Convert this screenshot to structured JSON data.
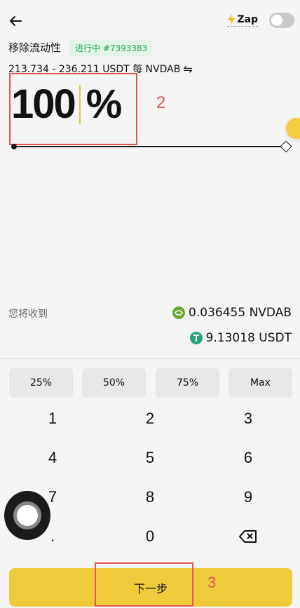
{
  "header": {
    "zap_label": "Zap"
  },
  "page": {
    "title": "移除流动性",
    "status_badge": "进行中 #7393383",
    "range_text": "213.734 - 236.211 USDT 每 NVDAB"
  },
  "amount": {
    "value": "100",
    "unit": "%",
    "percent_level": 1.0
  },
  "annotations": {
    "box_label_2": "2",
    "box_label_3": "3",
    "color": "#e05555"
  },
  "receive": {
    "label": "您将收到",
    "items": [
      {
        "amount": "0.036455 NVDAB",
        "icon": "nvidia-coin-icon",
        "color": "#6aa832"
      },
      {
        "amount": "9.13018 USDT",
        "icon": "usdt-coin-icon",
        "color": "#26a17b"
      }
    ]
  },
  "presets": [
    "25%",
    "50%",
    "75%",
    "Max"
  ],
  "keypad": {
    "rows": [
      [
        "1",
        "2",
        "3"
      ],
      [
        "4",
        "5",
        "6"
      ],
      [
        "7",
        "8",
        "9"
      ],
      [
        ".",
        "0",
        "backspace"
      ]
    ]
  },
  "next_button": {
    "label": "下一步"
  },
  "colors": {
    "accent": "#efcb3c",
    "badge_green": "#23a455"
  }
}
